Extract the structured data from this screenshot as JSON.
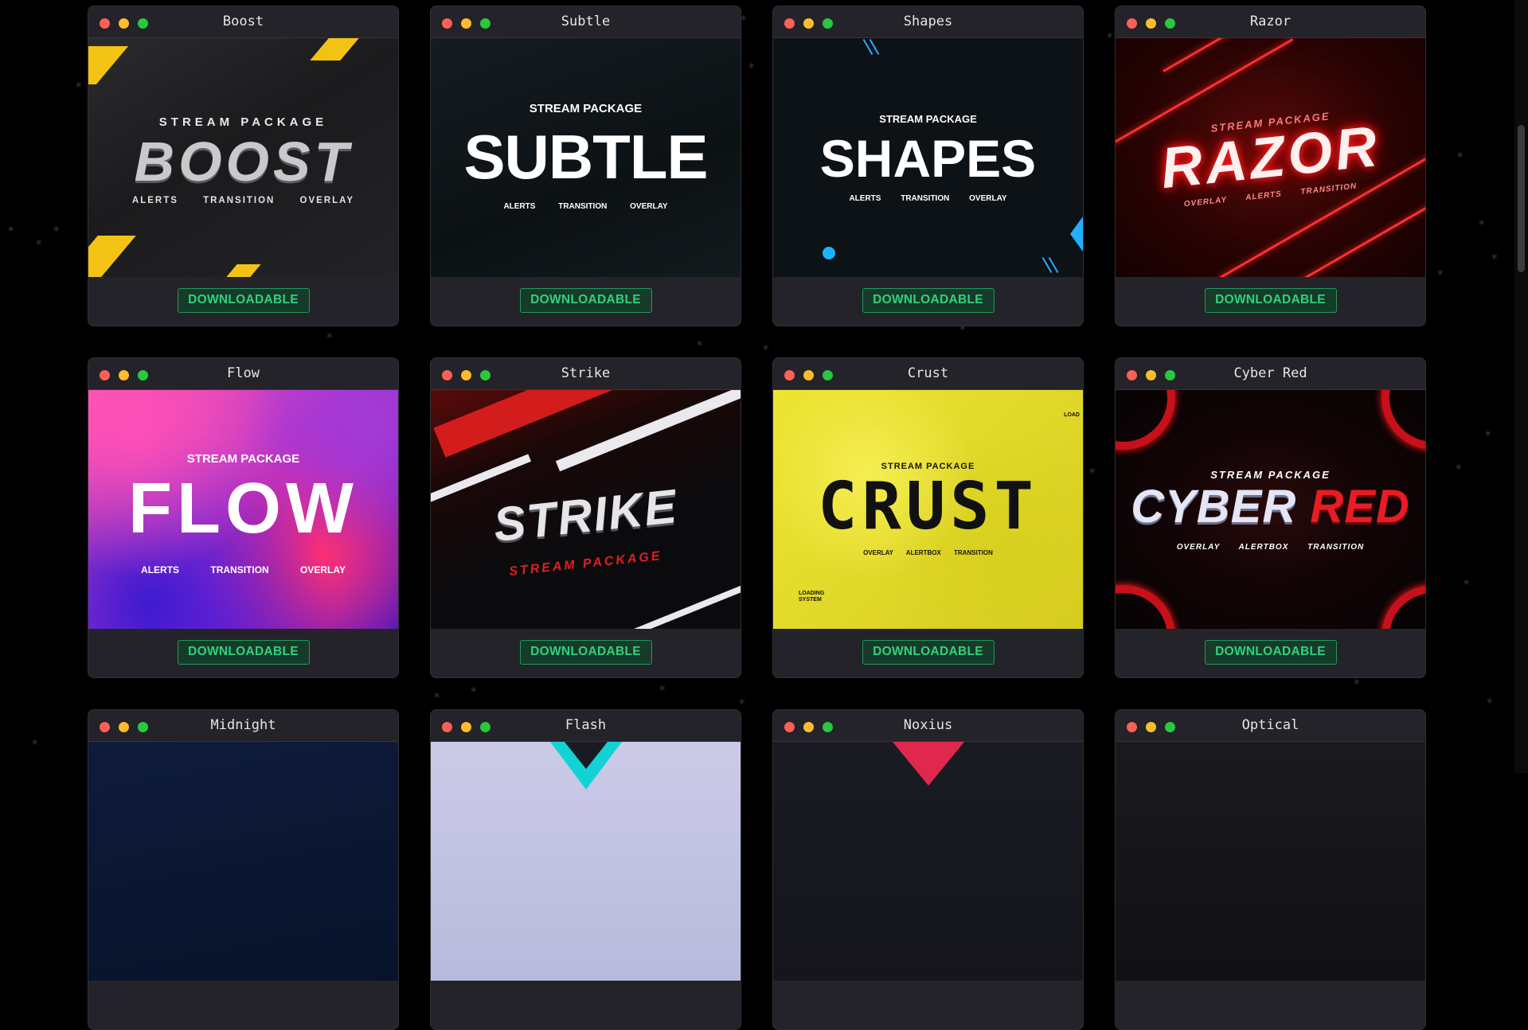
{
  "cards": [
    {
      "title": "Boost",
      "button": "DOWNLOADABLE",
      "pre": "STREAM PACKAGE",
      "big": "BOOST",
      "tags": "ALERTS TRANSITION OVERLAY"
    },
    {
      "title": "Subtle",
      "button": "DOWNLOADABLE",
      "pre": "STREAM PACKAGE",
      "big": "SUBTLE",
      "tags": "ALERTS TRANSITION OVERLAY"
    },
    {
      "title": "Shapes",
      "button": "DOWNLOADABLE",
      "pre": "STREAM PACKAGE",
      "big": "SHAPES",
      "tags": "ALERTS TRANSITION OVERLAY"
    },
    {
      "title": "Razor",
      "button": "DOWNLOADABLE",
      "pre": "STREAM PACKAGE",
      "big": "RAZOR",
      "tags": "OVERLAY ALERTS TRANSITION"
    },
    {
      "title": "Flow",
      "button": "DOWNLOADABLE",
      "pre": "STREAM PACKAGE",
      "big": "FLOW",
      "tags": "ALERTS TRANSITION OVERLAY"
    },
    {
      "title": "Strike",
      "button": "DOWNLOADABLE",
      "pre": "STREAM PACKAGE",
      "big": "STRIKE"
    },
    {
      "title": "Crust",
      "button": "DOWNLOADABLE",
      "pre": "STREAM PACKAGE",
      "big": "CRUST",
      "tags": "OVERLAY ALERTBOX TRANSITION",
      "side_left": "LOADING SYSTEM",
      "side_right": "LOAD"
    },
    {
      "title": "Cyber Red",
      "button": "DOWNLOADABLE",
      "pre": "STREAM PACKAGE",
      "big_a": "CYBER",
      "big_b": "RED",
      "tags": "OVERLAY ALERTBOX TRANSITION"
    },
    {
      "title": "Midnight"
    },
    {
      "title": "Flash"
    },
    {
      "title": "Noxius"
    },
    {
      "title": "Optical"
    }
  ],
  "colors": {
    "background": "#000000",
    "card": "#232329",
    "button_text": "#2fd27e",
    "button_border": "#1f9a58",
    "close_dot": "#ff5f57",
    "minimize_dot": "#febc2e",
    "maximize_dot": "#28c840"
  }
}
